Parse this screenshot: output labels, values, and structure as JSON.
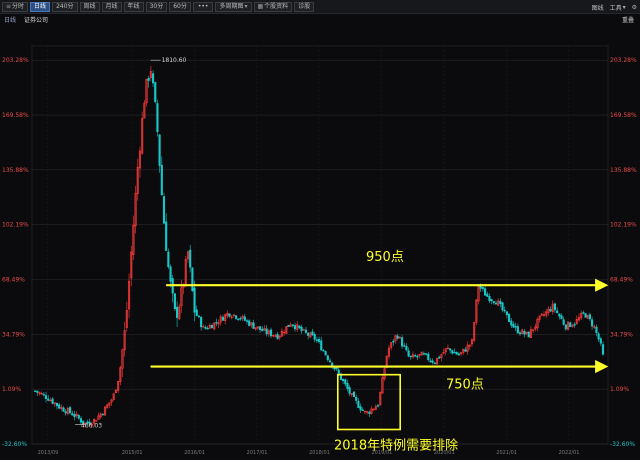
{
  "toolbar": {
    "tabs": [
      {
        "label": "分时",
        "icon": "menu-icon"
      },
      {
        "label": "日线",
        "active": true
      },
      {
        "label": "240分"
      },
      {
        "label": "周线"
      },
      {
        "label": "月线"
      },
      {
        "label": "年线"
      },
      {
        "label": "30分"
      },
      {
        "label": "60分"
      },
      {
        "label": "•••"
      },
      {
        "label": "多周期图",
        "icon": "dropdown-icon"
      },
      {
        "label": "个股资料",
        "icon": "grid-icon"
      },
      {
        "label": "诊股"
      }
    ],
    "right": {
      "chart_label": "图线",
      "tools_label": "工具",
      "settings_icon": "gear-icon"
    }
  },
  "subheader": {
    "period": "日线",
    "name": "证券公司",
    "adjust_label": "重叠"
  },
  "colors": {
    "up": "#ff3b3b",
    "down": "#19c8c8",
    "annotation": "#ffff2a",
    "axis_percent": "#e84b4b",
    "axis_negative": "#1fc6c6",
    "grid": "#2a2a2e"
  },
  "annotations": {
    "upper_label": "950点",
    "lower_label": "750点",
    "box_label": "2018年特例需要排除"
  },
  "chart_data": {
    "type": "candlestick",
    "title": "",
    "y_axis": {
      "unit": "%",
      "ticks": [
        "203.28%",
        "169.58%",
        "135.88%",
        "102.19%",
        "68.49%",
        "34.79%",
        "1.09%",
        "-32.60%"
      ],
      "tick_values": [
        203.28,
        169.58,
        135.88,
        102.19,
        68.49,
        34.79,
        1.09,
        -32.6
      ],
      "ylim": [
        -32.6,
        212
      ]
    },
    "x_axis": {
      "date_ticks": [
        "2013/09",
        "2015/01",
        "2016/01",
        "2017/01",
        "2018/01",
        "2019/01",
        "2020/01",
        "2021/01",
        "2022/01"
      ]
    },
    "extremes": {
      "high_label": "1810.60",
      "high_pct": 203.28,
      "low_label": "466.03",
      "low_pct": -20.5
    },
    "reference_lines": [
      {
        "label": "950点",
        "value_pct": 65.0,
        "from_year": 2015.6,
        "to_year": 2022.65
      },
      {
        "label": "750点",
        "value_pct": 15.0,
        "from_year": 2015.35,
        "to_year": 2022.65
      }
    ],
    "highlight_box": {
      "label": "2018年特例需要排除",
      "from_year": 2018.35,
      "to_year": 2019.35,
      "y_low_pct": -20.0,
      "y_high_pct": 10.0
    },
    "series": [
      {
        "year": 2013.5,
        "value": 0
      },
      {
        "year": 2013.7,
        "value": -4
      },
      {
        "year": 2013.9,
        "value": -10
      },
      {
        "year": 2014.1,
        "value": -14
      },
      {
        "year": 2014.3,
        "value": -20
      },
      {
        "year": 2014.45,
        "value": -18
      },
      {
        "year": 2014.6,
        "value": -12
      },
      {
        "year": 2014.75,
        "value": -4
      },
      {
        "year": 2014.85,
        "value": 10
      },
      {
        "year": 2014.95,
        "value": 40
      },
      {
        "year": 2015.05,
        "value": 90
      },
      {
        "year": 2015.15,
        "value": 140
      },
      {
        "year": 2015.25,
        "value": 180
      },
      {
        "year": 2015.35,
        "value": 200
      },
      {
        "year": 2015.45,
        "value": 165
      },
      {
        "year": 2015.55,
        "value": 110
      },
      {
        "year": 2015.65,
        "value": 70
      },
      {
        "year": 2015.75,
        "value": 45
      },
      {
        "year": 2015.85,
        "value": 60
      },
      {
        "year": 2015.95,
        "value": 85
      },
      {
        "year": 2016.05,
        "value": 50
      },
      {
        "year": 2016.2,
        "value": 38
      },
      {
        "year": 2016.4,
        "value": 42
      },
      {
        "year": 2016.6,
        "value": 48
      },
      {
        "year": 2016.8,
        "value": 45
      },
      {
        "year": 2017.0,
        "value": 40
      },
      {
        "year": 2017.2,
        "value": 36
      },
      {
        "year": 2017.4,
        "value": 34
      },
      {
        "year": 2017.6,
        "value": 42
      },
      {
        "year": 2017.8,
        "value": 36
      },
      {
        "year": 2018.0,
        "value": 32
      },
      {
        "year": 2018.2,
        "value": 20
      },
      {
        "year": 2018.4,
        "value": 8
      },
      {
        "year": 2018.6,
        "value": -5
      },
      {
        "year": 2018.8,
        "value": -14
      },
      {
        "year": 2019.0,
        "value": -8
      },
      {
        "year": 2019.15,
        "value": 25
      },
      {
        "year": 2019.3,
        "value": 35
      },
      {
        "year": 2019.5,
        "value": 20
      },
      {
        "year": 2019.7,
        "value": 22
      },
      {
        "year": 2019.9,
        "value": 18
      },
      {
        "year": 2020.1,
        "value": 26
      },
      {
        "year": 2020.3,
        "value": 22
      },
      {
        "year": 2020.5,
        "value": 30
      },
      {
        "year": 2020.6,
        "value": 65
      },
      {
        "year": 2020.75,
        "value": 58
      },
      {
        "year": 2020.9,
        "value": 55
      },
      {
        "year": 2021.05,
        "value": 46
      },
      {
        "year": 2021.2,
        "value": 38
      },
      {
        "year": 2021.4,
        "value": 34
      },
      {
        "year": 2021.6,
        "value": 45
      },
      {
        "year": 2021.8,
        "value": 52
      },
      {
        "year": 2022.0,
        "value": 40
      },
      {
        "year": 2022.15,
        "value": 42
      },
      {
        "year": 2022.3,
        "value": 48
      },
      {
        "year": 2022.45,
        "value": 40
      },
      {
        "year": 2022.55,
        "value": 30
      },
      {
        "year": 2022.62,
        "value": 18
      }
    ]
  }
}
